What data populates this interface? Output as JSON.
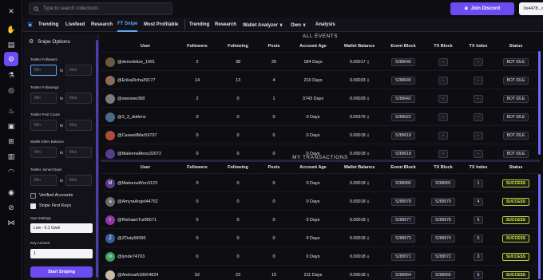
{
  "search": {
    "placeholder": "Type to search collections"
  },
  "header": {
    "discord_label": "Join Discord",
    "wallet_label": "0x4478...d934"
  },
  "nav": {
    "left_tabs": [
      "Trending",
      "Livefeed",
      "Research",
      "FT Snipe",
      "Most Profitable"
    ],
    "active_tab": "FT Snipe",
    "right_tabs": [
      "Trending",
      "Research",
      "Wallet Analyzer ∨",
      "Own ∨",
      "Analysis"
    ]
  },
  "panel": {
    "title": "Snipe Options",
    "filters": [
      {
        "label": "Twitter Followers",
        "min": "Min",
        "max": "Max"
      },
      {
        "label": "Twitter Followings",
        "min": "Min",
        "max": "Max"
      },
      {
        "label": "Twitter Post Count",
        "min": "Min",
        "max": "Max"
      },
      {
        "label": "Wallet Ether Balance",
        "min": "Min",
        "max": "Max"
      },
      {
        "label": "Twitter Joined Days",
        "min": "Min",
        "max": "Max"
      }
    ],
    "to_label": "to",
    "verified_label": "Verified Accounts",
    "snipe_first_label": "Snipe First Keys",
    "gas_label": "Gas Settings",
    "gas_value": "Low - 0.1 Gwei",
    "key_amount_label": "Key Amount",
    "key_amount_value": "1",
    "start_label": "Start Sniping"
  },
  "all_events": {
    "title": "ALL EVENTS",
    "columns": [
      "User",
      "Followers",
      "Following",
      "Posts",
      "Account Age",
      "Wallet Balance",
      "Event Block",
      "TX Block",
      "TX Index",
      "Status"
    ],
    "rows": [
      {
        "user": "@demobilize_1991",
        "followers": "2",
        "following": "38",
        "posts": "26",
        "age": "184 Days",
        "balance": "0.00017",
        "event_block": "5289646",
        "tx_block": "-",
        "tx_index": "-",
        "status": "BOT IDLE"
      },
      {
        "user": "@ErikaRicha39177",
        "followers": "14",
        "following": "13",
        "posts": "4",
        "age": "210 Days",
        "balance": "0.00033",
        "event_block": "5289645",
        "tx_block": "-",
        "tx_index": "-",
        "status": "BOT IDLE"
      },
      {
        "user": "@sweswe368",
        "followers": "2",
        "following": "0",
        "posts": "1",
        "age": "3743 Days",
        "balance": "0.00028",
        "event_block": "5289642",
        "tx_block": "-",
        "tx_index": "-",
        "status": "BOT IDLE"
      },
      {
        "user": "@3_3_dotlens",
        "followers": "0",
        "following": "0",
        "posts": "0",
        "age": "0 Days",
        "balance": "0.00376",
        "event_block": "5289622",
        "tx_block": "-",
        "tx_index": "-",
        "status": "BOT IDLE"
      },
      {
        "user": "@CaswellMar59797",
        "followers": "0",
        "following": "0",
        "posts": "0",
        "age": "0 Days",
        "balance": "0.00018",
        "event_block": "5289618",
        "tx_block": "-",
        "tx_index": "-",
        "status": "BOT IDLE"
      },
      {
        "user": "@MaleenaMess32072",
        "followers": "0",
        "following": "0",
        "posts": "0",
        "age": "0 Days",
        "balance": "0.00018",
        "event_block": "5289618",
        "tx_block": "-",
        "tx_index": "-",
        "status": "BOT IDLE"
      }
    ]
  },
  "my_transactions": {
    "title": "MY TRANSACTIONS",
    "columns": [
      "User",
      "Followers",
      "Following",
      "Posts",
      "Account Age",
      "Wallet Balance",
      "Event Block",
      "TX Block",
      "TX Index",
      "Status"
    ],
    "rows": [
      {
        "user": "@MaleenaWon3123",
        "initial": "M",
        "followers": "0",
        "following": "0",
        "posts": "0",
        "age": "0 Days",
        "balance": "0.00018",
        "event_block": "5289580",
        "tx_block": "5289581",
        "tx_index": "1",
        "status": "SUCCESS"
      },
      {
        "user": "@AmyraAngel44752",
        "initial": "a",
        "followers": "0",
        "following": "0",
        "posts": "0",
        "age": "0 Days",
        "balance": "0.00018",
        "event_block": "5289578",
        "tx_block": "5289579",
        "tx_index": "4",
        "status": "SUCCESS"
      },
      {
        "user": "@RishaanTur85671",
        "initial": "t",
        "followers": "0",
        "following": "0",
        "posts": "0",
        "age": "0 Days",
        "balance": "0.00018",
        "event_block": "5289577",
        "tx_block": "5289578",
        "tx_index": "6",
        "status": "SUCCESS"
      },
      {
        "user": "@ZDuty58090",
        "initial": "Z",
        "followers": "0",
        "following": "0",
        "posts": "0",
        "age": "0 Days",
        "balance": "0.00018",
        "event_block": "5289573",
        "tx_block": "5289574",
        "tx_index": "5",
        "status": "SUCCESS"
      },
      {
        "user": "@lynde74793",
        "initial": "m",
        "followers": "0",
        "following": "0",
        "posts": "0",
        "age": "0 Days",
        "balance": "0.00018",
        "event_block": "5289571",
        "tx_block": "5289572",
        "tx_index": "3",
        "status": "SUCCESS"
      },
      {
        "user": "@AndreaA18664824",
        "initial": "",
        "followers": "52",
        "following": "23",
        "posts": "10",
        "age": "211 Days",
        "balance": "0.00018",
        "event_block": "5289564",
        "tx_block": "5289565",
        "tx_index": "6",
        "status": "SUCCESS"
      }
    ]
  },
  "colors": {
    "accent": "#6c4cf0",
    "link": "#5aa9ff",
    "success": "#d8f050"
  }
}
